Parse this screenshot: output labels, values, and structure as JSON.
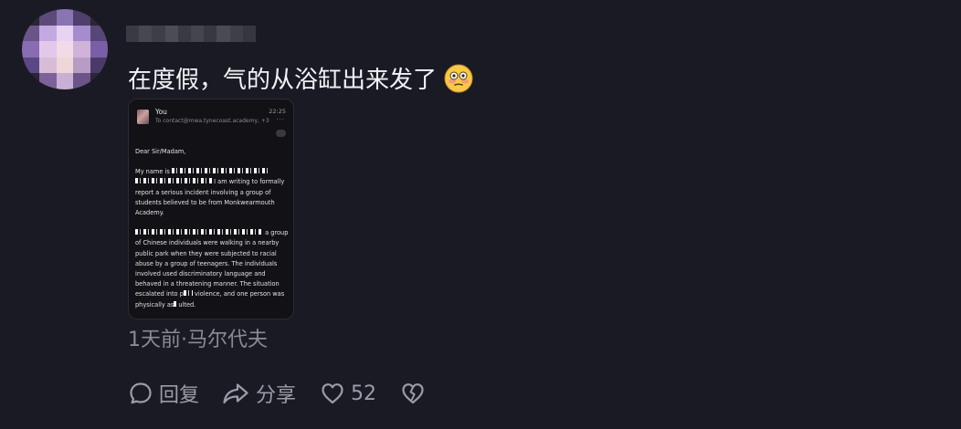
{
  "comment": {
    "text": "在度假，气的从浴缸出来发了",
    "emoji": "flushed-face-emoji",
    "meta": "1天前·马尔代夫"
  },
  "attachment": {
    "email": {
      "sender": "You",
      "time": "22:25",
      "to": "To contact@mwa.tynecoast.academy, +3",
      "more": "···",
      "greeting": "Dear Sir/Madam,",
      "p1_start": "My name is",
      "p1_end": "I am writing to formally report a serious incident involving a group of students believed to be from Monkwearmouth Academy.",
      "p2_end": "a group of Chinese individuals were walking in a nearby public park when they were subjected to racial abuse by a group of teenagers. The individuals involved used discriminatory language and behaved in a threatening manner. The situation escalated into",
      "p2_tail1": "violence, and one person was physically as",
      "p2_tail2": "ulted."
    }
  },
  "actions": {
    "reply_label": "回复",
    "share_label": "分享",
    "like_count": "52"
  },
  "colors": {
    "background": "#1a1a24",
    "text": "#f2f2f6",
    "muted": "#8b8b96"
  }
}
